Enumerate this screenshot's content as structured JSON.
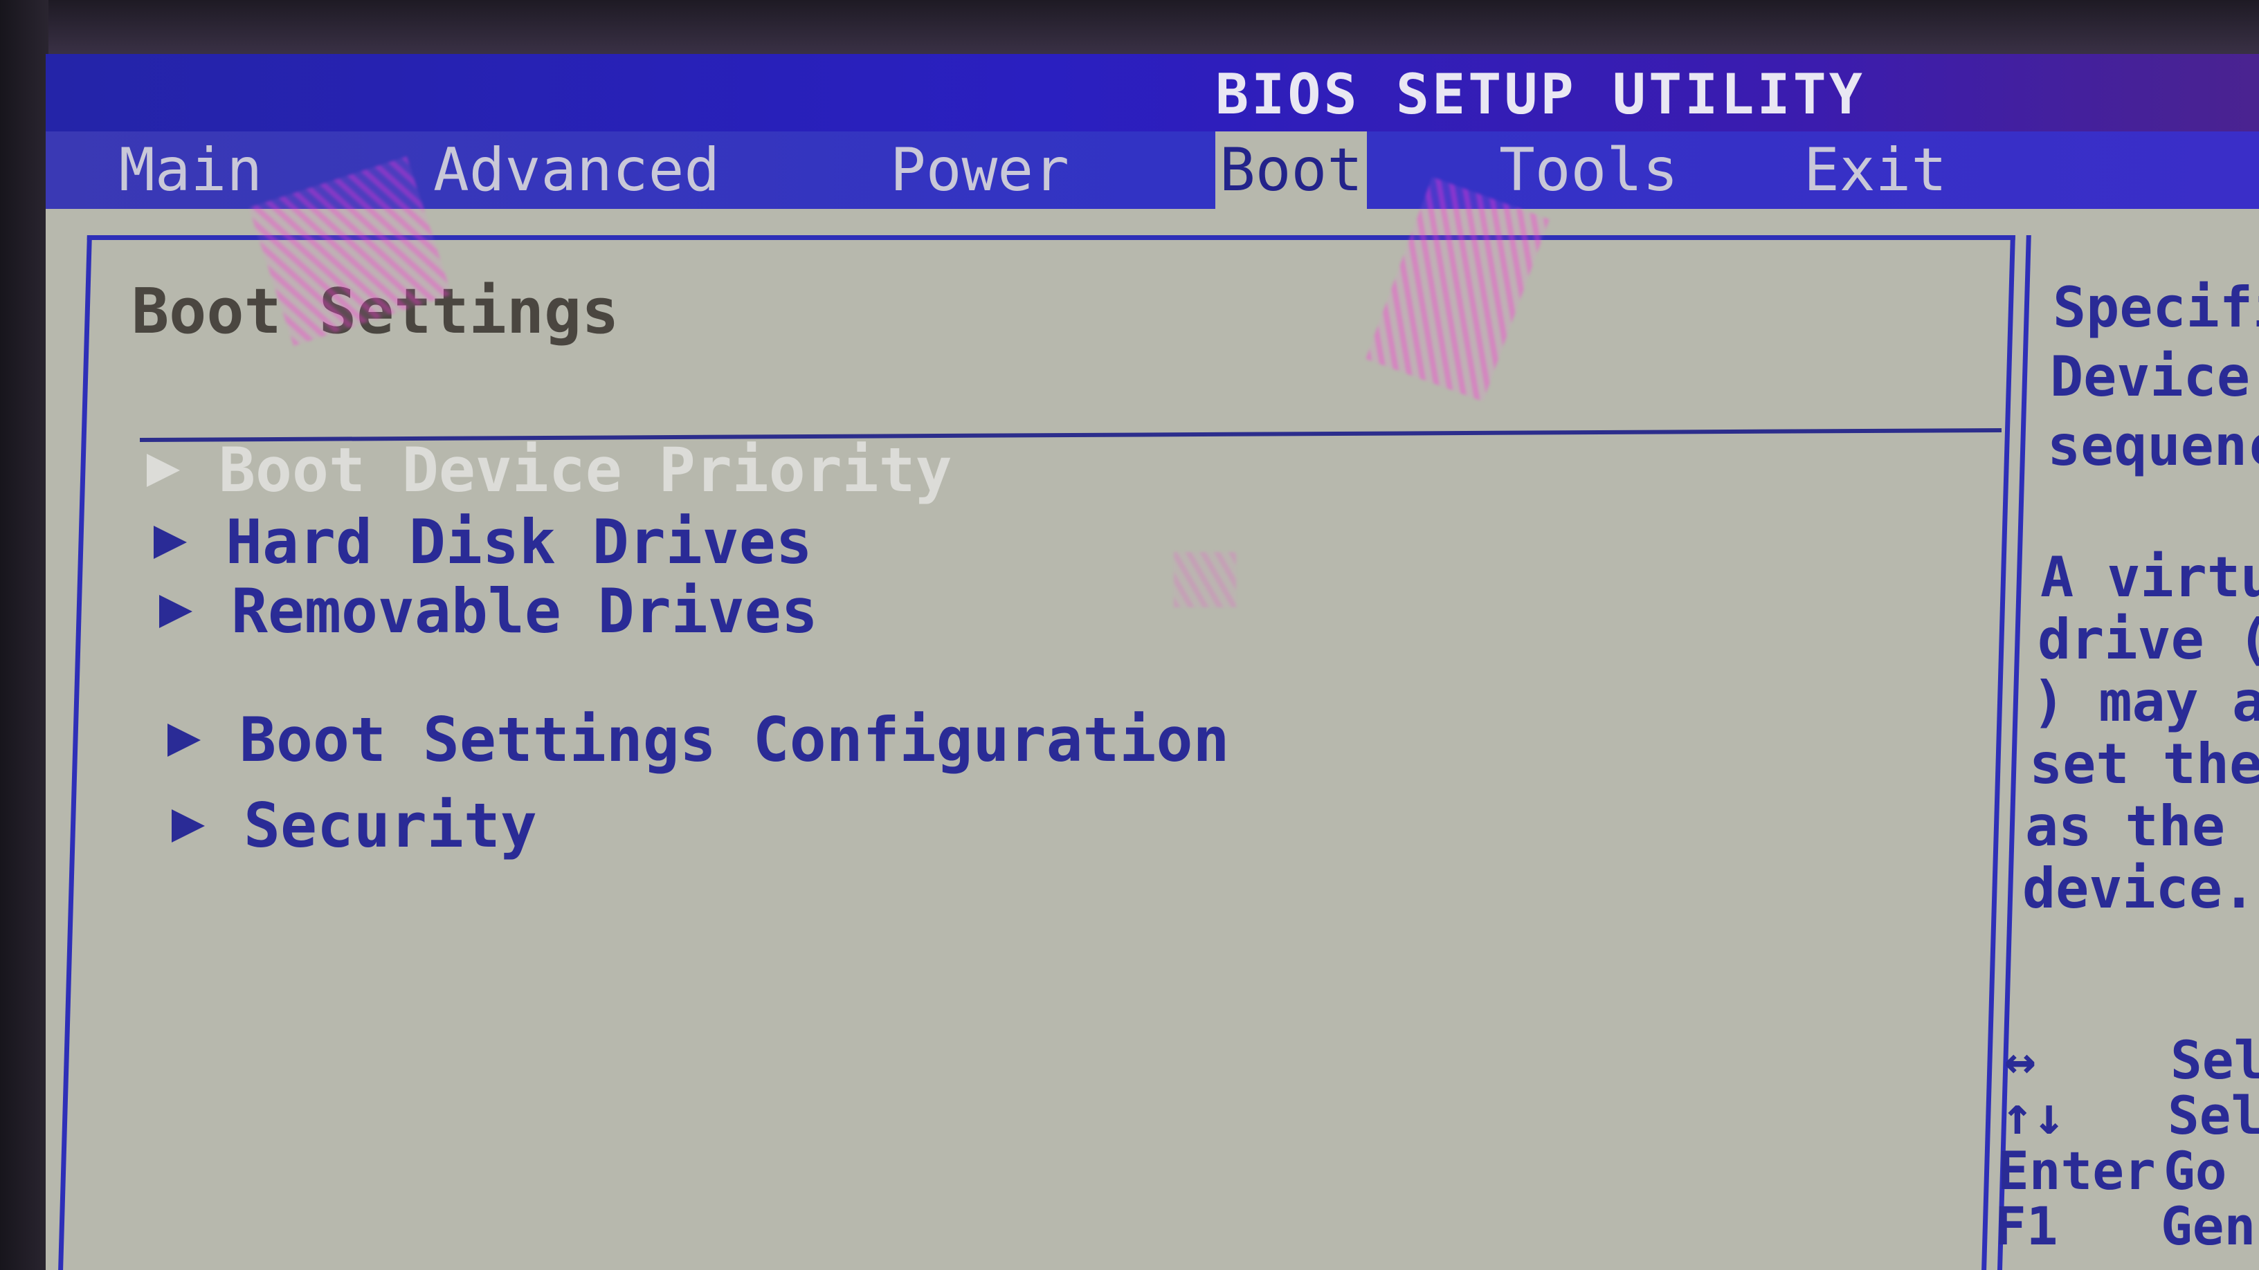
{
  "window": {
    "title": "BIOS SETUP UTILITY"
  },
  "menu": {
    "items": [
      {
        "label": "Main"
      },
      {
        "label": "Advanced"
      },
      {
        "label": "Power"
      },
      {
        "label": "Boot"
      },
      {
        "label": "Tools"
      },
      {
        "label": "Exit"
      }
    ],
    "active": "Boot"
  },
  "main": {
    "title": "Boot Settings",
    "entries": [
      {
        "label": "Boot Device Priority",
        "selected": true
      },
      {
        "label": "Hard Disk Drives"
      },
      {
        "label": "Removable Drives"
      },
      {
        "label": "Boot Settings Configuration"
      },
      {
        "label": "Security"
      }
    ]
  },
  "help": {
    "lines": [
      "Specifi",
      "Device",
      "sequenc",
      "A virtu",
      "drive (",
      ") may ap",
      "set the",
      "as the f",
      "device."
    ],
    "keys": [
      {
        "key": "↔",
        "desc": "Sel"
      },
      {
        "key": "↑↓",
        "desc": "Sel"
      },
      {
        "key": "Enter",
        "desc": "Go"
      },
      {
        "key": "F1",
        "desc": "Gen"
      }
    ]
  },
  "colors": {
    "title_bar": "#2424a8",
    "menu_bar": "#3233c4",
    "panel_bg": "#b7b8ad",
    "text_blue": "#2a2b96",
    "highlight_text": "#dcdcd8",
    "glare": "#ff3cdc"
  }
}
